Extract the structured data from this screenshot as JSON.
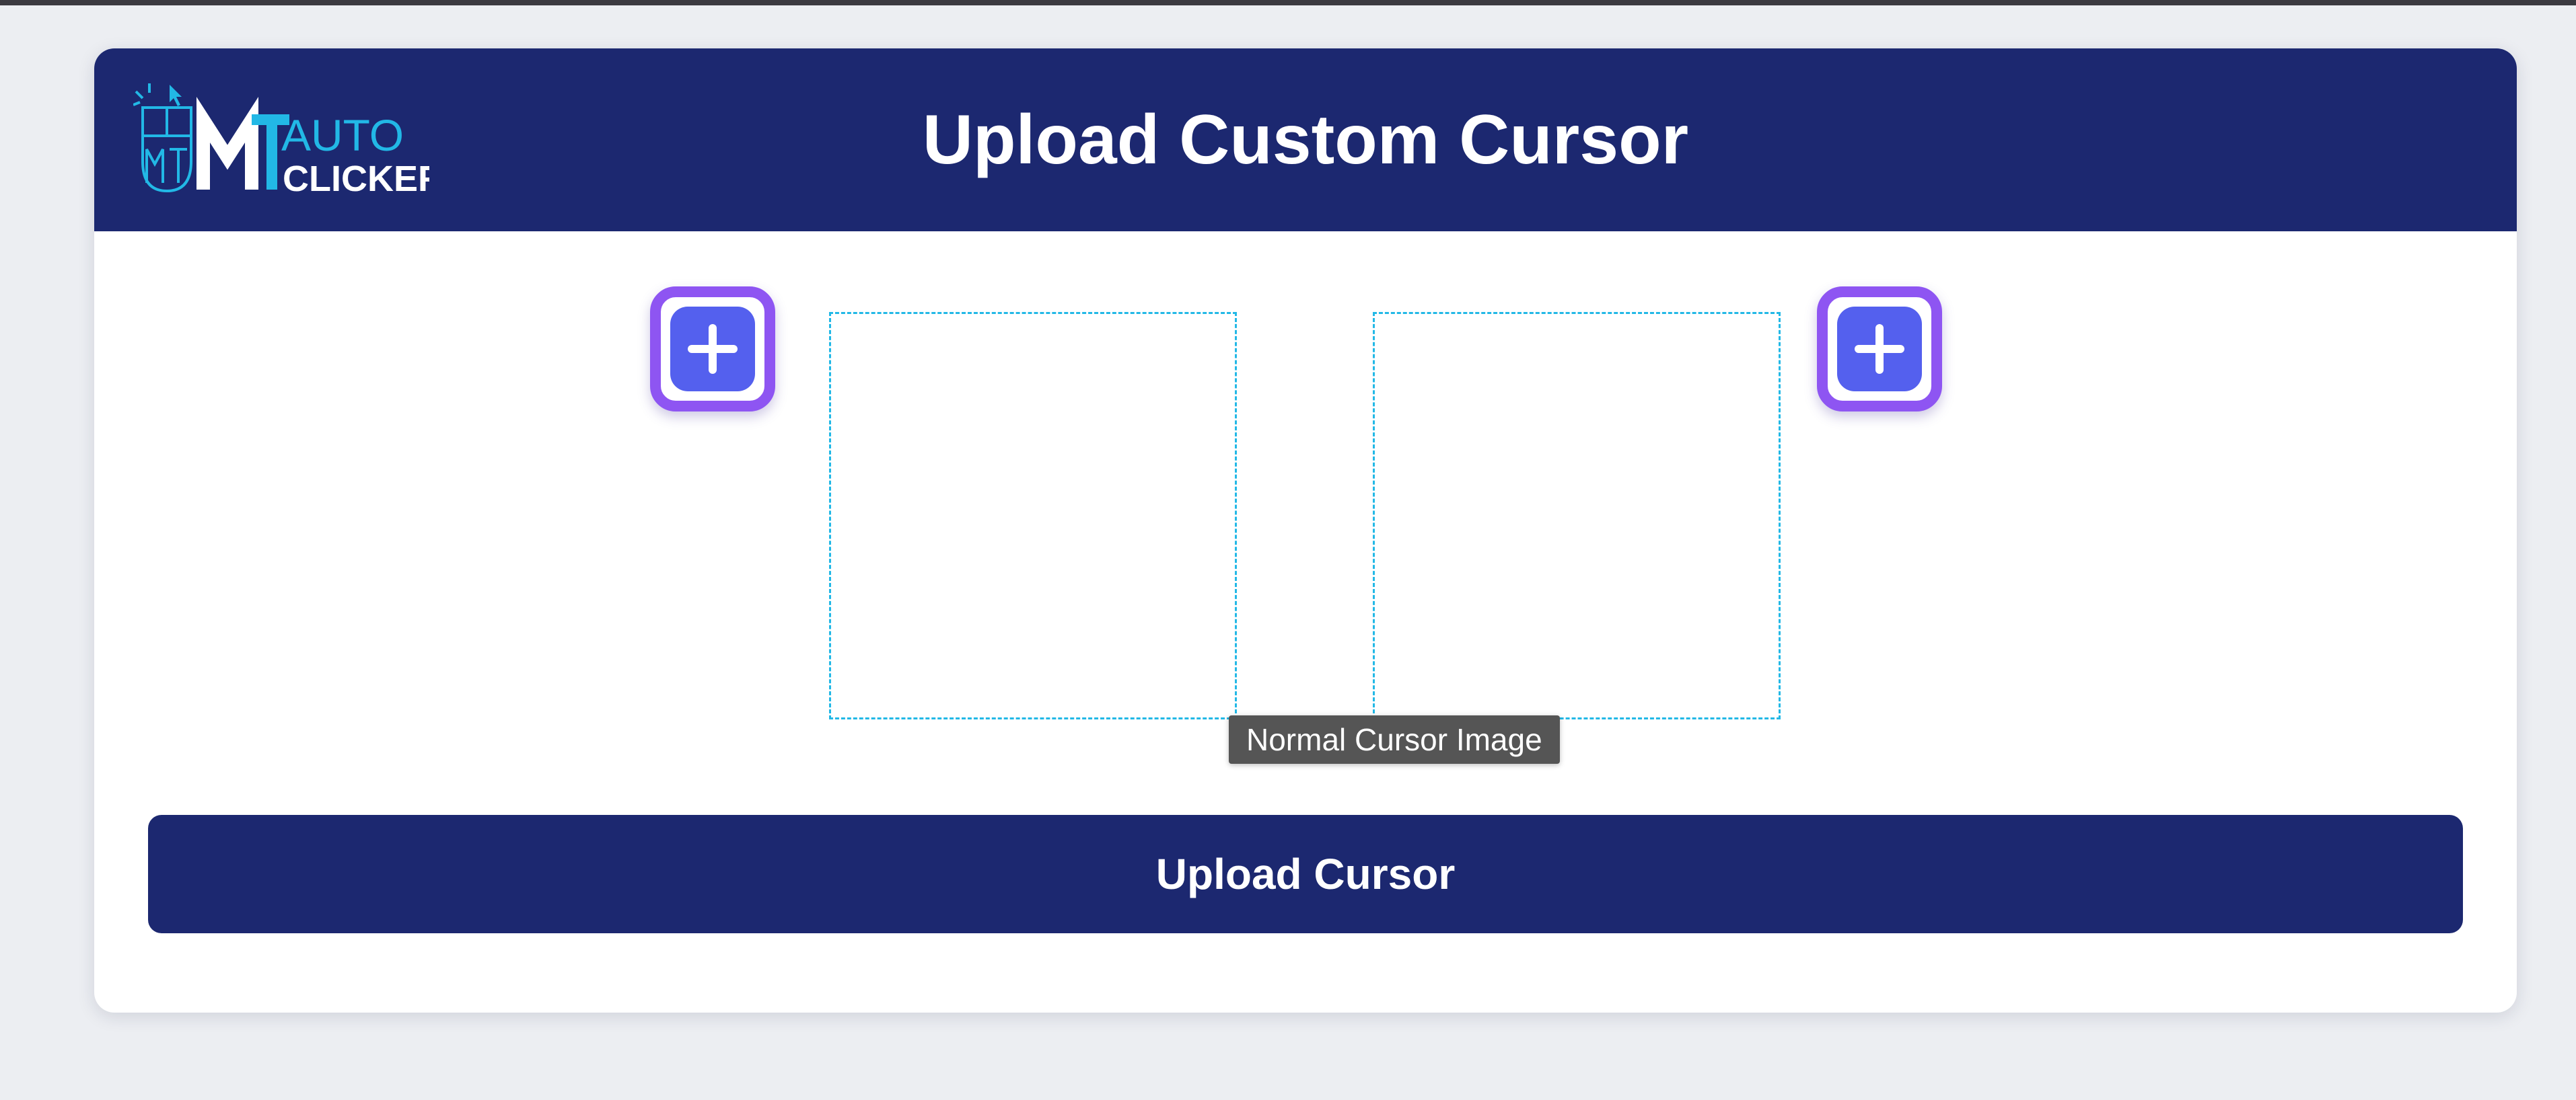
{
  "header": {
    "title": "Upload Custom Cursor",
    "logo": {
      "text_top": "AUTO",
      "text_bottom": "CLICKER",
      "icon": "mt-mouse-logo",
      "colors": {
        "primary": "#22b8e6",
        "white": "#ffffff"
      }
    }
  },
  "upload_slots": {
    "left_add_icon": "plus-icon",
    "right_add_icon": "plus-icon"
  },
  "tooltip": {
    "text": "Normal Cursor Image"
  },
  "actions": {
    "upload_label": "Upload Cursor"
  },
  "colors": {
    "header_bg": "#1c2870",
    "add_border": "#8e55f2",
    "add_fill": "#5460ee",
    "dropzone_border": "#22b8e6",
    "page_bg": "#eceef2"
  }
}
